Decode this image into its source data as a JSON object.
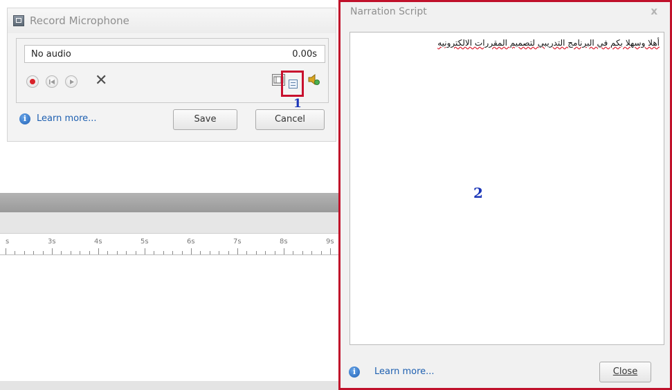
{
  "record_panel": {
    "title": "Record Microphone",
    "audio_status": "No audio",
    "audio_time": "0.00s",
    "learn_more": "Learn more...",
    "save_label": "Save",
    "cancel_label": "Cancel",
    "callout": "1",
    "icons": {
      "app": "microphone-app-icon",
      "record": "record-icon",
      "rewind": "rewind-icon",
      "play": "play-icon",
      "delete": "delete-icon",
      "device": "filmstrip-icon",
      "script": "narration-script-icon",
      "narration": "speaker-icon",
      "info": "info-icon"
    },
    "colors": {
      "highlight": "#c8102e",
      "callout": "#1a35b8",
      "link": "#1d5fb0",
      "record": "#d8232a"
    }
  },
  "timeline": {
    "ruler_labels": [
      "s",
      "3s",
      "4s",
      "5s",
      "6s",
      "7s",
      "8s",
      "9s"
    ]
  },
  "narration_panel": {
    "title": "Narration Script",
    "close_x": "x",
    "script_text": "أهلا وسهلا بكم في البرنامج التدريبي لتصميم المقررات الالكترونيه",
    "callout": "2",
    "learn_more": "Learn more...",
    "close_label": "Close"
  }
}
